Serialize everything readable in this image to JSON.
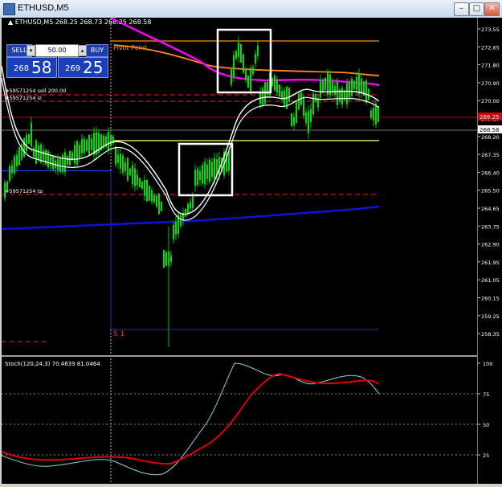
{
  "window": {
    "title": "ETHUSD,M5",
    "buttons": {
      "minimize": "–",
      "maximize": "□",
      "close": "✕"
    },
    "icon": "chart-window-icon"
  },
  "trade_panel": {
    "sell_label": "SELL",
    "buy_label": "BUY",
    "lot": "50.00",
    "sell_small": "268",
    "sell_big": "58",
    "buy_small": "269",
    "buy_big": "25",
    "stepper_down": "▾",
    "stepper_up": "▴"
  },
  "main_chart": {
    "header": "▲ ETHUSD,M5  268.25 268.73 268.25 268.58",
    "labels": {
      "pivot": "Pivot Point",
      "s1": "S 1",
      "sell_order": "#59571254 sell 200.00",
      "sl": "#59571254 sl",
      "tp": "#59571254 tp"
    },
    "price_axis": [
      "273.55",
      "272.65",
      "271.80",
      "270.90",
      "270.00",
      "269.10",
      "268.20",
      "267.35",
      "266.40",
      "265.50",
      "264.65",
      "263.75",
      "262.90",
      "261.95",
      "261.05",
      "260.15",
      "259.25",
      "258.35"
    ],
    "current_price_tag": "268.58",
    "sell_price_tag": "269.25",
    "colors": {
      "candles": "#00e000",
      "pivot": "#ff8c1a",
      "ma_magenta": "#ff00ff",
      "ma_blue": "#0000e0",
      "ma_white": "#ffffff",
      "order_line": "#ff0000"
    }
  },
  "stoch_panel": {
    "header": "Stoch(120,24,3) 70.4639 81.0464",
    "axis": [
      "100",
      "75",
      "50",
      "25",
      "0"
    ],
    "colors": {
      "main": "#7fd6d6",
      "signal": "#e00000"
    }
  }
}
